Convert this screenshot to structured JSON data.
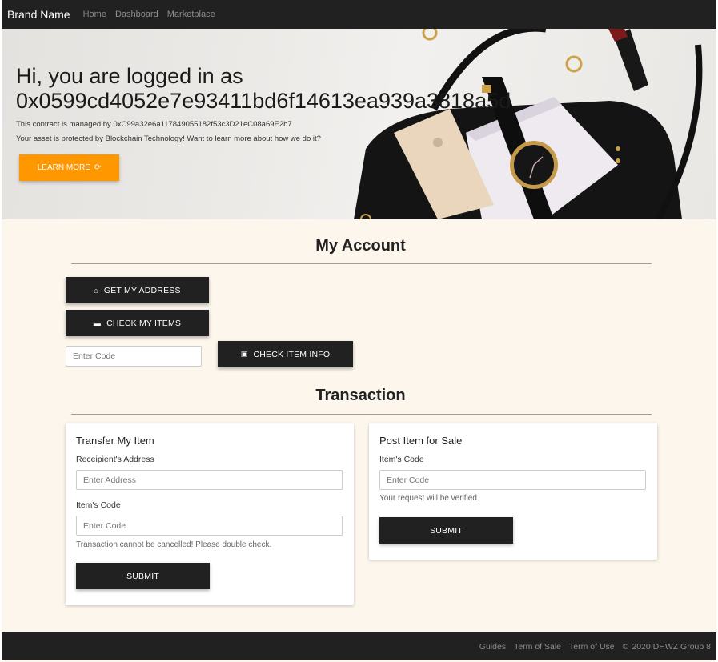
{
  "nav": {
    "brand": "Brand Name",
    "links": [
      "Home",
      "Dashboard",
      "Marketplace"
    ]
  },
  "hero": {
    "title": "Hi, you are logged in as 0x0599cd4052e7e93411bd6f14613ea939a3818a5d",
    "contract_line": "This contract is managed by 0xC99a32e6a117849055182f53c3D21eC08a69E2b7",
    "protect_line": "Your asset is protected by Blockchain Technology! Want to learn more about how we do it?",
    "learn_more": "LEARN MORE"
  },
  "account": {
    "heading": "My Account",
    "get_address": "GET MY ADDRESS",
    "check_items": "CHECK MY ITEMS",
    "code_placeholder": "Enter Code",
    "check_item_info": "CHECK ITEM INFO"
  },
  "transaction": {
    "heading": "Transaction",
    "transfer": {
      "title": "Transfer My Item",
      "address_label": "Receipient's Address",
      "address_placeholder": "Enter Address",
      "code_label": "Item's Code",
      "code_placeholder": "Enter Code",
      "warning": "Transaction cannot be cancelled! Please double check.",
      "submit": "SUBMIT"
    },
    "post": {
      "title": "Post Item for Sale",
      "code_label": "Item's Code",
      "code_placeholder": "Enter Code",
      "note": "Your request will be verified.",
      "submit": "SUBMIT"
    }
  },
  "footer": {
    "links": [
      "Guides",
      "Term of Sale",
      "Term of Use"
    ],
    "copyright": "2020 DHWZ Group 8"
  },
  "colors": {
    "nav_bg": "#212121",
    "accent": "#ff9800",
    "page_bg": "#fdf6ec"
  },
  "icons": {
    "home": "home-icon",
    "items": "inbox-icon",
    "info": "info-icon",
    "learn": "refresh-icon",
    "copyright": "copyright-icon"
  }
}
